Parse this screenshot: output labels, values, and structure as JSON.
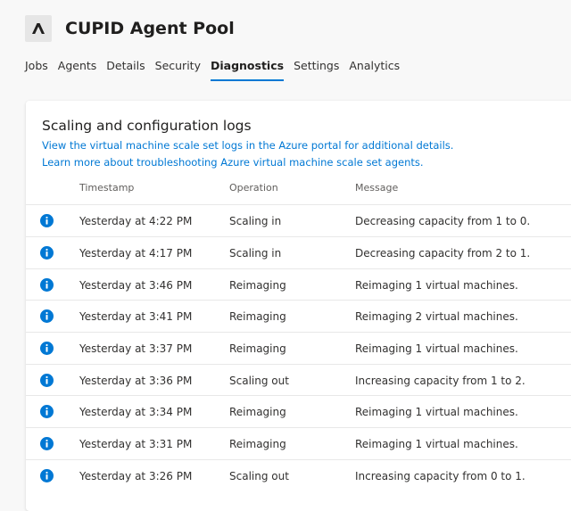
{
  "header": {
    "title": "CUPID Agent Pool",
    "icon": "azure-devops-logo-icon"
  },
  "tabs": [
    {
      "label": "Jobs"
    },
    {
      "label": "Agents"
    },
    {
      "label": "Details"
    },
    {
      "label": "Security"
    },
    {
      "label": "Diagnostics",
      "active": true
    },
    {
      "label": "Settings"
    },
    {
      "label": "Analytics"
    }
  ],
  "logs": {
    "title": "Scaling and configuration logs",
    "link_portal": "View the virtual machine scale set logs in the Azure portal for additional details.",
    "link_learn": "Learn more about troubleshooting Azure virtual machine scale set agents.",
    "columns": {
      "timestamp": "Timestamp",
      "operation": "Operation",
      "message": "Message"
    },
    "rows": [
      {
        "icon": "info-icon",
        "timestamp": "Yesterday at 4:22 PM",
        "operation": "Scaling in",
        "message": "Decreasing capacity from 1 to 0."
      },
      {
        "icon": "info-icon",
        "timestamp": "Yesterday at 4:17 PM",
        "operation": "Scaling in",
        "message": "Decreasing capacity from 2 to 1."
      },
      {
        "icon": "info-icon",
        "timestamp": "Yesterday at 3:46 PM",
        "operation": "Reimaging",
        "message": "Reimaging 1 virtual machines."
      },
      {
        "icon": "info-icon",
        "timestamp": "Yesterday at 3:41 PM",
        "operation": "Reimaging",
        "message": "Reimaging 2 virtual machines."
      },
      {
        "icon": "info-icon",
        "timestamp": "Yesterday at 3:37 PM",
        "operation": "Reimaging",
        "message": "Reimaging 1 virtual machines."
      },
      {
        "icon": "info-icon",
        "timestamp": "Yesterday at 3:36 PM",
        "operation": "Scaling out",
        "message": "Increasing capacity from 1 to 2."
      },
      {
        "icon": "info-icon",
        "timestamp": "Yesterday at 3:34 PM",
        "operation": "Reimaging",
        "message": "Reimaging 1 virtual machines."
      },
      {
        "icon": "info-icon",
        "timestamp": "Yesterday at 3:31 PM",
        "operation": "Reimaging",
        "message": "Reimaging 1 virtual machines."
      },
      {
        "icon": "info-icon",
        "timestamp": "Yesterday at 3:26 PM",
        "operation": "Scaling out",
        "message": "Increasing capacity from 0 to 1."
      }
    ]
  },
  "colors": {
    "accent": "#0078d4",
    "info_icon": "#0078d4"
  }
}
